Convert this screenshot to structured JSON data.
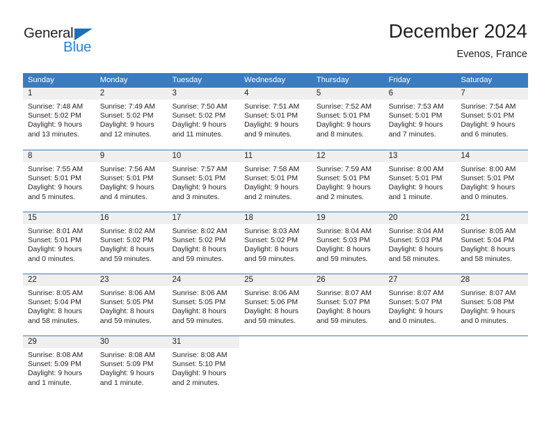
{
  "brand": {
    "name_part1": "General",
    "name_part2": "Blue",
    "color_dark": "#231f20",
    "color_blue": "#2086d6",
    "triangle_color": "#1f6fb8"
  },
  "header": {
    "title": "December 2024",
    "subtitle": "Evenos, France"
  },
  "theme": {
    "header_blue": "#3b7cc0",
    "daynum_background": "#efefef",
    "text": "#231f20"
  },
  "weekday_headers": [
    "Sunday",
    "Monday",
    "Tuesday",
    "Wednesday",
    "Thursday",
    "Friday",
    "Saturday"
  ],
  "weeks": [
    {
      "days": [
        {
          "date": "1",
          "sunrise": "Sunrise: 7:48 AM",
          "sunset": "Sunset: 5:02 PM",
          "daylight_line1": "Daylight: 9 hours",
          "daylight_line2": "and 13 minutes."
        },
        {
          "date": "2",
          "sunrise": "Sunrise: 7:49 AM",
          "sunset": "Sunset: 5:02 PM",
          "daylight_line1": "Daylight: 9 hours",
          "daylight_line2": "and 12 minutes."
        },
        {
          "date": "3",
          "sunrise": "Sunrise: 7:50 AM",
          "sunset": "Sunset: 5:02 PM",
          "daylight_line1": "Daylight: 9 hours",
          "daylight_line2": "and 11 minutes."
        },
        {
          "date": "4",
          "sunrise": "Sunrise: 7:51 AM",
          "sunset": "Sunset: 5:01 PM",
          "daylight_line1": "Daylight: 9 hours",
          "daylight_line2": "and 9 minutes."
        },
        {
          "date": "5",
          "sunrise": "Sunrise: 7:52 AM",
          "sunset": "Sunset: 5:01 PM",
          "daylight_line1": "Daylight: 9 hours",
          "daylight_line2": "and 8 minutes."
        },
        {
          "date": "6",
          "sunrise": "Sunrise: 7:53 AM",
          "sunset": "Sunset: 5:01 PM",
          "daylight_line1": "Daylight: 9 hours",
          "daylight_line2": "and 7 minutes."
        },
        {
          "date": "7",
          "sunrise": "Sunrise: 7:54 AM",
          "sunset": "Sunset: 5:01 PM",
          "daylight_line1": "Daylight: 9 hours",
          "daylight_line2": "and 6 minutes."
        }
      ]
    },
    {
      "days": [
        {
          "date": "8",
          "sunrise": "Sunrise: 7:55 AM",
          "sunset": "Sunset: 5:01 PM",
          "daylight_line1": "Daylight: 9 hours",
          "daylight_line2": "and 5 minutes."
        },
        {
          "date": "9",
          "sunrise": "Sunrise: 7:56 AM",
          "sunset": "Sunset: 5:01 PM",
          "daylight_line1": "Daylight: 9 hours",
          "daylight_line2": "and 4 minutes."
        },
        {
          "date": "10",
          "sunrise": "Sunrise: 7:57 AM",
          "sunset": "Sunset: 5:01 PM",
          "daylight_line1": "Daylight: 9 hours",
          "daylight_line2": "and 3 minutes."
        },
        {
          "date": "11",
          "sunrise": "Sunrise: 7:58 AM",
          "sunset": "Sunset: 5:01 PM",
          "daylight_line1": "Daylight: 9 hours",
          "daylight_line2": "and 2 minutes."
        },
        {
          "date": "12",
          "sunrise": "Sunrise: 7:59 AM",
          "sunset": "Sunset: 5:01 PM",
          "daylight_line1": "Daylight: 9 hours",
          "daylight_line2": "and 2 minutes."
        },
        {
          "date": "13",
          "sunrise": "Sunrise: 8:00 AM",
          "sunset": "Sunset: 5:01 PM",
          "daylight_line1": "Daylight: 9 hours",
          "daylight_line2": "and 1 minute."
        },
        {
          "date": "14",
          "sunrise": "Sunrise: 8:00 AM",
          "sunset": "Sunset: 5:01 PM",
          "daylight_line1": "Daylight: 9 hours",
          "daylight_line2": "and 0 minutes."
        }
      ]
    },
    {
      "days": [
        {
          "date": "15",
          "sunrise": "Sunrise: 8:01 AM",
          "sunset": "Sunset: 5:01 PM",
          "daylight_line1": "Daylight: 9 hours",
          "daylight_line2": "and 0 minutes."
        },
        {
          "date": "16",
          "sunrise": "Sunrise: 8:02 AM",
          "sunset": "Sunset: 5:02 PM",
          "daylight_line1": "Daylight: 8 hours",
          "daylight_line2": "and 59 minutes."
        },
        {
          "date": "17",
          "sunrise": "Sunrise: 8:02 AM",
          "sunset": "Sunset: 5:02 PM",
          "daylight_line1": "Daylight: 8 hours",
          "daylight_line2": "and 59 minutes."
        },
        {
          "date": "18",
          "sunrise": "Sunrise: 8:03 AM",
          "sunset": "Sunset: 5:02 PM",
          "daylight_line1": "Daylight: 8 hours",
          "daylight_line2": "and 59 minutes."
        },
        {
          "date": "19",
          "sunrise": "Sunrise: 8:04 AM",
          "sunset": "Sunset: 5:03 PM",
          "daylight_line1": "Daylight: 8 hours",
          "daylight_line2": "and 59 minutes."
        },
        {
          "date": "20",
          "sunrise": "Sunrise: 8:04 AM",
          "sunset": "Sunset: 5:03 PM",
          "daylight_line1": "Daylight: 8 hours",
          "daylight_line2": "and 58 minutes."
        },
        {
          "date": "21",
          "sunrise": "Sunrise: 8:05 AM",
          "sunset": "Sunset: 5:04 PM",
          "daylight_line1": "Daylight: 8 hours",
          "daylight_line2": "and 58 minutes."
        }
      ]
    },
    {
      "days": [
        {
          "date": "22",
          "sunrise": "Sunrise: 8:05 AM",
          "sunset": "Sunset: 5:04 PM",
          "daylight_line1": "Daylight: 8 hours",
          "daylight_line2": "and 58 minutes."
        },
        {
          "date": "23",
          "sunrise": "Sunrise: 8:06 AM",
          "sunset": "Sunset: 5:05 PM",
          "daylight_line1": "Daylight: 8 hours",
          "daylight_line2": "and 59 minutes."
        },
        {
          "date": "24",
          "sunrise": "Sunrise: 8:06 AM",
          "sunset": "Sunset: 5:05 PM",
          "daylight_line1": "Daylight: 8 hours",
          "daylight_line2": "and 59 minutes."
        },
        {
          "date": "25",
          "sunrise": "Sunrise: 8:06 AM",
          "sunset": "Sunset: 5:06 PM",
          "daylight_line1": "Daylight: 8 hours",
          "daylight_line2": "and 59 minutes."
        },
        {
          "date": "26",
          "sunrise": "Sunrise: 8:07 AM",
          "sunset": "Sunset: 5:07 PM",
          "daylight_line1": "Daylight: 8 hours",
          "daylight_line2": "and 59 minutes."
        },
        {
          "date": "27",
          "sunrise": "Sunrise: 8:07 AM",
          "sunset": "Sunset: 5:07 PM",
          "daylight_line1": "Daylight: 9 hours",
          "daylight_line2": "and 0 minutes."
        },
        {
          "date": "28",
          "sunrise": "Sunrise: 8:07 AM",
          "sunset": "Sunset: 5:08 PM",
          "daylight_line1": "Daylight: 9 hours",
          "daylight_line2": "and 0 minutes."
        }
      ]
    },
    {
      "days": [
        {
          "date": "29",
          "sunrise": "Sunrise: 8:08 AM",
          "sunset": "Sunset: 5:09 PM",
          "daylight_line1": "Daylight: 9 hours",
          "daylight_line2": "and 1 minute."
        },
        {
          "date": "30",
          "sunrise": "Sunrise: 8:08 AM",
          "sunset": "Sunset: 5:09 PM",
          "daylight_line1": "Daylight: 9 hours",
          "daylight_line2": "and 1 minute."
        },
        {
          "date": "31",
          "sunrise": "Sunrise: 8:08 AM",
          "sunset": "Sunset: 5:10 PM",
          "daylight_line1": "Daylight: 9 hours",
          "daylight_line2": "and 2 minutes."
        },
        {
          "date": "",
          "sunrise": "",
          "sunset": "",
          "daylight_line1": "",
          "daylight_line2": ""
        },
        {
          "date": "",
          "sunrise": "",
          "sunset": "",
          "daylight_line1": "",
          "daylight_line2": ""
        },
        {
          "date": "",
          "sunrise": "",
          "sunset": "",
          "daylight_line1": "",
          "daylight_line2": ""
        },
        {
          "date": "",
          "sunrise": "",
          "sunset": "",
          "daylight_line1": "",
          "daylight_line2": ""
        }
      ]
    }
  ]
}
